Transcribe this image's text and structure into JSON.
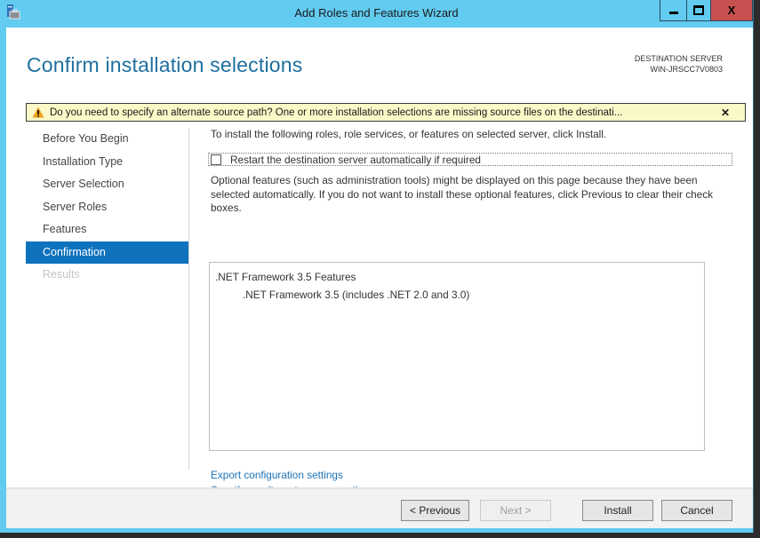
{
  "window": {
    "title": "Add Roles and Features Wizard",
    "controls": {
      "minimize": "minimize",
      "maximize": "maximize",
      "close_label": "X"
    }
  },
  "header": {
    "page_title": "Confirm installation selections",
    "destination_label": "DESTINATION SERVER",
    "destination_value": "WIN-JRSCC7V0803"
  },
  "banner": {
    "icon": "warning-icon",
    "text": "Do you need to specify an alternate source path? One or more installation selections are missing source files on the destinati...",
    "close_label": "✕"
  },
  "sidebar": {
    "items": [
      {
        "label": "Before You Begin",
        "state": "normal"
      },
      {
        "label": "Installation Type",
        "state": "normal"
      },
      {
        "label": "Server Selection",
        "state": "normal"
      },
      {
        "label": "Server Roles",
        "state": "normal"
      },
      {
        "label": "Features",
        "state": "normal"
      },
      {
        "label": "Confirmation",
        "state": "active"
      },
      {
        "label": "Results",
        "state": "disabled"
      }
    ]
  },
  "content": {
    "intro": "To install the following roles, role services, or features on selected server, click Install.",
    "restart_checkbox": {
      "label": "Restart the destination server automatically if required",
      "checked": false
    },
    "optional_note": "Optional features (such as administration tools) might be displayed on this page because they have been selected automatically. If you do not want to install these optional features, click Previous to clear their check boxes.",
    "selections": [
      {
        "label": ".NET Framework 3.5 Features",
        "level": 0
      },
      {
        "label": ".NET Framework 3.5 (includes .NET 2.0 and 3.0)",
        "level": 1
      }
    ],
    "links": {
      "export": "Export configuration settings",
      "alternate_source": "Specify an alternate source path"
    }
  },
  "footer": {
    "previous": "< Previous",
    "next": "Next >",
    "install": "Install",
    "cancel": "Cancel"
  },
  "colors": {
    "frame": "#62cbf0",
    "accent": "#0e72bd",
    "title_text": "#1e6f9f",
    "link": "#1e73b5",
    "banner_bg": "#fbf9c8",
    "close_button": "#c75050"
  }
}
